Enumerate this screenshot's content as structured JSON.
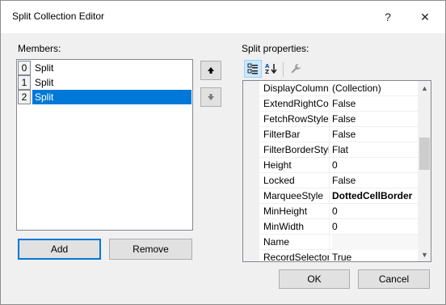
{
  "window": {
    "title": "Split Collection Editor",
    "help_glyph": "?",
    "close_glyph": "✕"
  },
  "members": {
    "label": "Members:",
    "items": [
      {
        "index": "0",
        "name": "Split",
        "selected": false
      },
      {
        "index": "1",
        "name": "Split",
        "selected": false
      },
      {
        "index": "2",
        "name": "Split",
        "selected": true
      }
    ],
    "add_label": "Add",
    "remove_label": "Remove"
  },
  "properties": {
    "label": "Split properties:",
    "rows": [
      {
        "name": "DisplayColumn",
        "value": "(Collection)",
        "bold": false
      },
      {
        "name": "ExtendRightCo",
        "value": "False",
        "bold": false
      },
      {
        "name": "FetchRowStyles",
        "value": "False",
        "bold": false
      },
      {
        "name": "FilterBar",
        "value": "False",
        "bold": false
      },
      {
        "name": "FilterBorderStyl",
        "value": "Flat",
        "bold": false
      },
      {
        "name": "Height",
        "value": "0",
        "bold": false
      },
      {
        "name": "Locked",
        "value": "False",
        "bold": false
      },
      {
        "name": "MarqueeStyle",
        "value": "DottedCellBorder",
        "bold": true
      },
      {
        "name": "MinHeight",
        "value": "0",
        "bold": false
      },
      {
        "name": "MinWidth",
        "value": "0",
        "bold": false
      },
      {
        "name": "Name",
        "value": "",
        "bold": false
      },
      {
        "name": "RecordSelector",
        "value": "True",
        "bold": false
      }
    ]
  },
  "footer": {
    "ok_label": "OK",
    "cancel_label": "Cancel"
  },
  "colors": {
    "selection": "#0078d7",
    "default_button_border": "#0078d7"
  }
}
